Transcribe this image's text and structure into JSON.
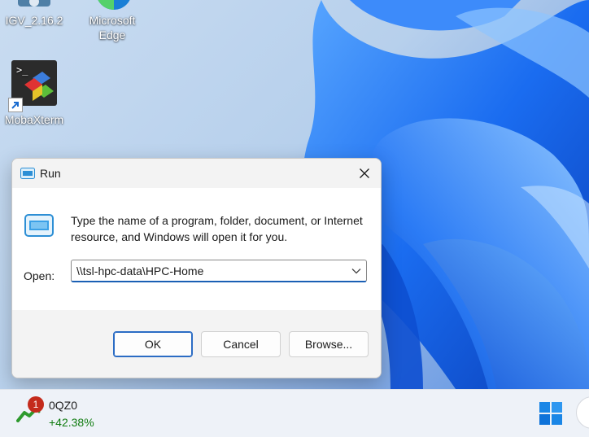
{
  "desktop": {
    "icons": [
      {
        "label": "IGV_2.16.2"
      },
      {
        "label": "Microsoft Edge"
      },
      {
        "label": "MobaXterm"
      }
    ]
  },
  "run_dialog": {
    "title": "Run",
    "description": "Type the name of a program, folder, document, or Internet resource, and Windows will open it for you.",
    "open_label": "Open:",
    "open_value": "\\\\tsl-hpc-data\\HPC-Home",
    "ok_label": "OK",
    "cancel_label": "Cancel",
    "browse_label": "Browse..."
  },
  "taskbar": {
    "widget": {
      "badge": "1",
      "name": "0QZ0",
      "change": "+42.38%",
      "change_color": "#107c10"
    }
  },
  "colors": {
    "accent": "#0067c0",
    "wallpaper_blue": "#1565e6"
  }
}
